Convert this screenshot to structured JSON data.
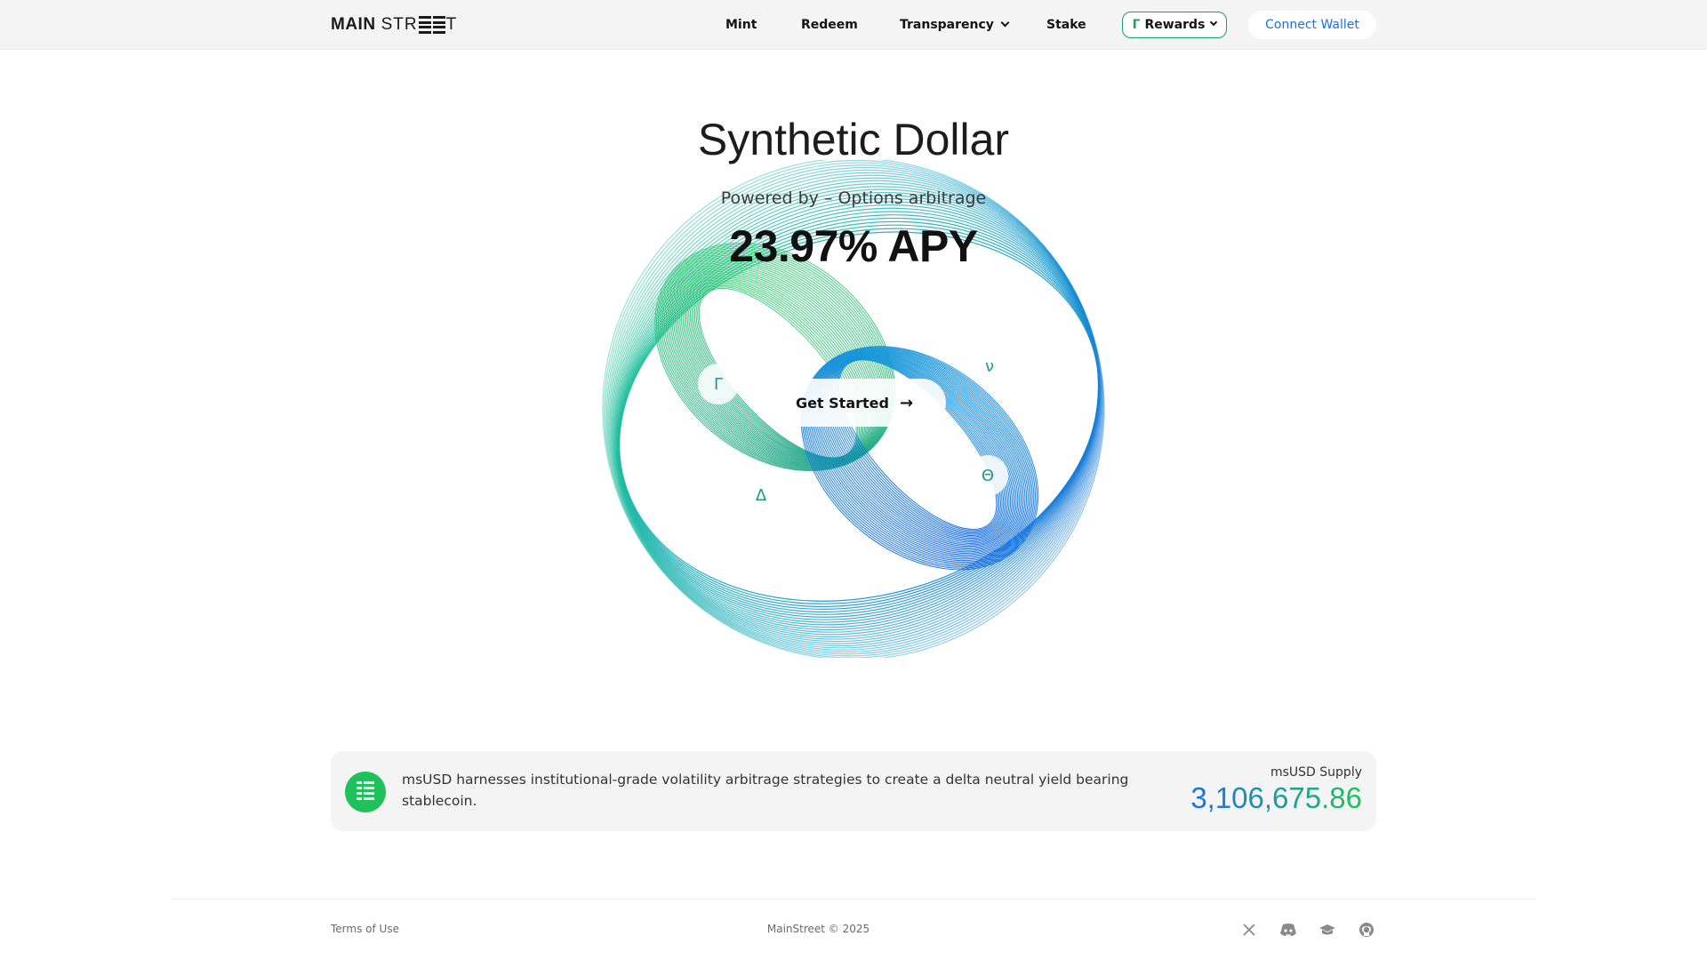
{
  "header": {
    "logo_main": "MAIN",
    "logo_street_prefix": "STR",
    "logo_street_suffix": "T",
    "nav": [
      "Mint",
      "Redeem",
      "Transparency",
      "Stake"
    ],
    "rewards_label": "Rewards",
    "rewards_icon": "Γ",
    "connect_label": "Connect Wallet",
    "accent_blue": "#1a72e8",
    "accent_green": "#1aa06b"
  },
  "hero": {
    "title": "Synthetic Dollar",
    "subtitle": "Powered by – Options arbitrage",
    "apy": "23.97% APY",
    "greeks": [
      "Γ",
      "ν",
      "Δ",
      "Θ"
    ],
    "cta_label": "Get Started",
    "cta_icon": "arrow-right-icon"
  },
  "info": {
    "description": "msUSD harnesses institutional-grade volatility arbitrage strategies to create a delta neutral yield bearing stablecoin.",
    "supply_label": "msUSD Supply",
    "supply_value": "3,106,675.86"
  },
  "footer": {
    "terms": "Terms of Use",
    "copyright": "MainStreet © 2025",
    "social_icons": [
      "x-icon",
      "discord-icon",
      "docs-icon",
      "github-icon"
    ]
  }
}
